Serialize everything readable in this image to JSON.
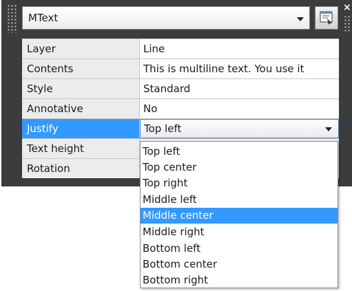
{
  "palette": {
    "object_type": "MText",
    "close_glyph": "×",
    "quick_select_icon": "quick-select-icon"
  },
  "properties": [
    {
      "name": "Layer",
      "value": "Line"
    },
    {
      "name": "Contents",
      "value": "This is multiline text. You use it"
    },
    {
      "name": "Style",
      "value": "Standard"
    },
    {
      "name": "Annotative",
      "value": "No"
    },
    {
      "name": "Justify",
      "value": "Top left"
    },
    {
      "name": "Text height",
      "value": ""
    },
    {
      "name": "Rotation",
      "value": ""
    }
  ],
  "justify_dropdown": {
    "options": [
      "Top left",
      "Top center",
      "Top right",
      "Middle left",
      "Middle center",
      "Middle right",
      "Bottom left",
      "Bottom center",
      "Bottom right"
    ],
    "highlighted": "Middle center"
  },
  "colors": {
    "palette_background": "#3b3c3e",
    "selection": "#3399ff",
    "label_cell": "#ececec"
  }
}
